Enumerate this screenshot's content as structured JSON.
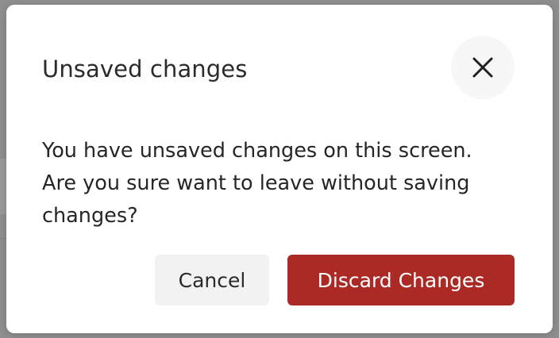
{
  "dialog": {
    "title": "Unsaved changes",
    "message": "You have unsaved changes on this screen. Are you sure want to leave without saving changes?",
    "close_icon": "close-icon",
    "buttons": {
      "cancel_label": "Cancel",
      "discard_label": "Discard Changes"
    }
  },
  "colors": {
    "overlay": "#8f8f8f",
    "modal_background": "#ffffff",
    "discard_button": "#ab2a25",
    "cancel_button": "#f2f2f2",
    "close_button_background": "#f7f7f7"
  }
}
